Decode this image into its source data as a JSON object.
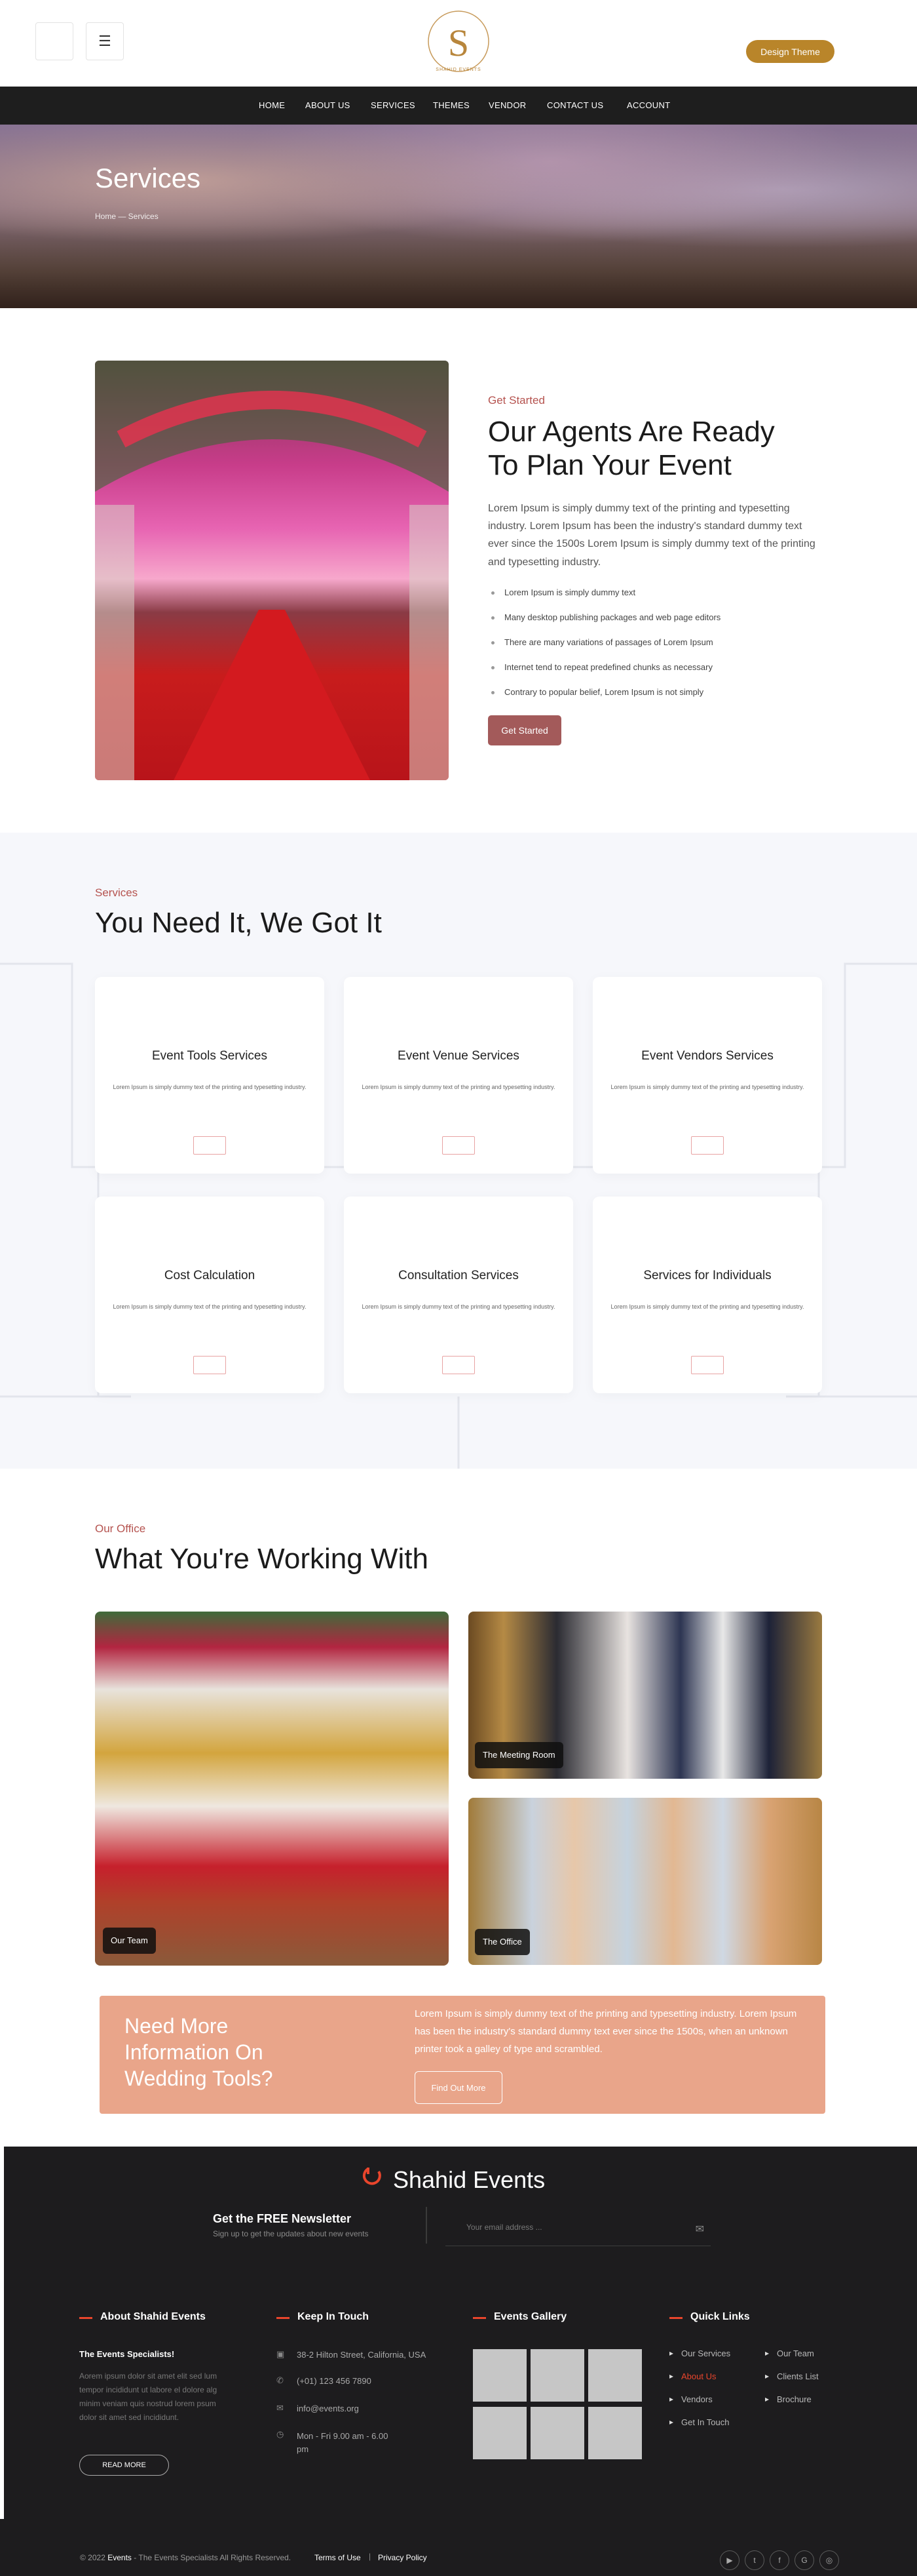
{
  "header": {
    "logo_text": "SHAHID EVENTS",
    "logo_letter": "S",
    "theme_button": "Design Theme",
    "nav": [
      "HOME",
      "ABOUT US",
      "SERVICES",
      "THEMES",
      "VENDOR",
      "CONTACT US",
      "ACCOUNT"
    ]
  },
  "hero": {
    "title": "Services",
    "breadcrumb": "Home — Services"
  },
  "about": {
    "eyebrow": "Get Started",
    "title_line1": "Our Agents Are Ready",
    "title_line2": "To Plan Your Event",
    "paragraph": "Lorem Ipsum is simply dummy text of the printing and typesetting industry. Lorem Ipsum has been the industry's standard dummy text ever since the 1500s Lorem Ipsum is simply dummy text of the printing and typesetting industry.",
    "list": [
      "Lorem Ipsum is simply dummy text",
      "Many desktop publishing packages and web page editors",
      "There are many variations of passages of Lorem Ipsum",
      "Internet tend to repeat predefined chunks as necessary",
      "Contrary to popular belief, Lorem Ipsum is not simply"
    ],
    "button": "Get Started"
  },
  "services": {
    "eyebrow": "Services",
    "title": "You Need It, We Got It",
    "cards": [
      {
        "title": "Event Tools Services",
        "desc": "Lorem Ipsum is simply dummy text of the printing and typesetting industry."
      },
      {
        "title": "Event Venue Services",
        "desc": "Lorem Ipsum is simply dummy text of the printing and typesetting industry."
      },
      {
        "title": "Event Vendors Services",
        "desc": "Lorem Ipsum is simply dummy text of the printing and typesetting industry."
      },
      {
        "title": "Cost Calculation",
        "desc": "Lorem Ipsum is simply dummy text of the printing and typesetting industry."
      },
      {
        "title": "Consultation Services",
        "desc": "Lorem Ipsum is simply dummy text of the printing and typesetting industry."
      },
      {
        "title": "Services for Individuals",
        "desc": "Lorem Ipsum is simply dummy text of the printing and typesetting industry."
      }
    ]
  },
  "office": {
    "eyebrow": "Our Office",
    "title": "What You're Working With",
    "tiles": [
      "Our Team",
      "The Meeting Room",
      "The Office"
    ]
  },
  "cta": {
    "title": "Need More Information On Wedding Tools?",
    "text": "Lorem Ipsum is simply dummy text of the printing and typesetting industry. Lorem Ipsum has been the industry's standard dummy text ever since the 1500s, when an unknown printer took a galley of type and scrambled.",
    "button": "Find Out More"
  },
  "footer": {
    "brand": "Shahid Events",
    "newsletter_title": "Get the FREE Newsletter",
    "newsletter_sub": "Sign up to get the updates about new events",
    "email_placeholder": "Your email address ...",
    "about_head": "About Shahid Events",
    "about_sub": "The Events Specialists!",
    "about_text": "Aorem ipsum dolor sit amet elit sed lum tempor incididunt ut labore el dolore alg minim veniam quis nostrud lorem psum dolor sit amet sed incididunt.",
    "read_more": "READ MORE",
    "touch_head": "Keep In Touch",
    "address": "38-2 Hilton Street, California, USA",
    "phone": "(+01) 123 456 7890",
    "email": "info@events.org",
    "hours": "Mon - Fri 9.00 am - 6.00 pm",
    "gallery_head": "Events Gallery",
    "links_head": "Quick Links",
    "links": [
      "Our Services",
      "Our Team",
      "About Us",
      "Clients List",
      "Vendors",
      "Brochure",
      "Get In Touch"
    ],
    "copyright_prefix": "© 2022",
    "copyright_brand": "Events",
    "copyright_suffix": "- The Events Specialists All Rights Reserved.",
    "terms": "Terms of Use",
    "privacy": "Privacy Policy",
    "social": [
      "youtube-icon",
      "twitter-icon",
      "facebook-icon",
      "google-plus-icon",
      "instagram-icon"
    ],
    "accent": "#e9452c"
  }
}
